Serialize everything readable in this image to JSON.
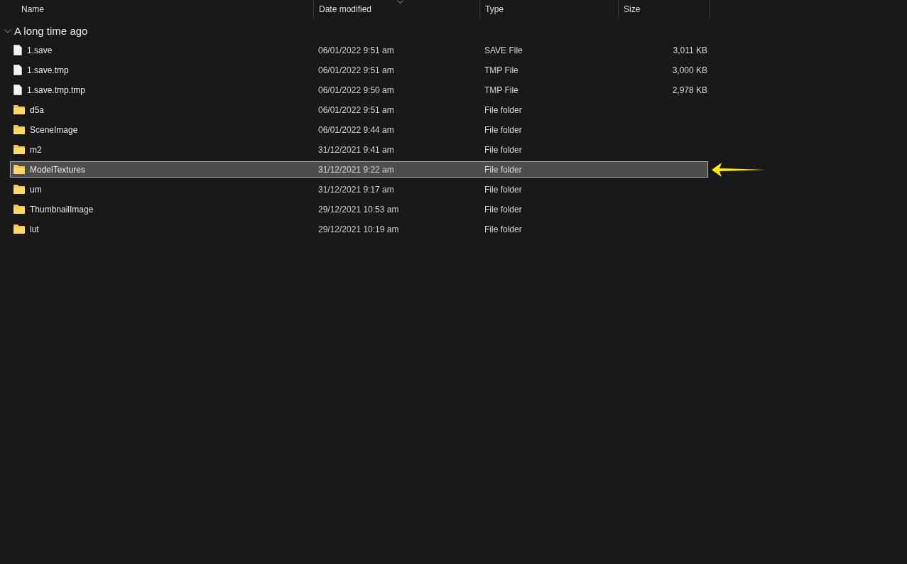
{
  "columns": [
    {
      "label": "Name",
      "sorted": false
    },
    {
      "label": "Date modified",
      "sorted": true
    },
    {
      "label": "Type",
      "sorted": false
    },
    {
      "label": "Size",
      "sorted": false
    }
  ],
  "group": {
    "label": "A long time ago",
    "expanded": true
  },
  "rows": [
    {
      "kind": "file",
      "name": "1.save",
      "date": "06/01/2022 9:51 am",
      "type": "SAVE File",
      "size": "3,011 KB",
      "selected": false
    },
    {
      "kind": "file",
      "name": "1.save.tmp",
      "date": "06/01/2022 9:51 am",
      "type": "TMP File",
      "size": "3,000 KB",
      "selected": false
    },
    {
      "kind": "file",
      "name": "1.save.tmp.tmp",
      "date": "06/01/2022 9:50 am",
      "type": "TMP File",
      "size": "2,978 KB",
      "selected": false
    },
    {
      "kind": "folder",
      "name": "d5a",
      "date": "06/01/2022 9:51 am",
      "type": "File folder",
      "selected": false
    },
    {
      "kind": "folder",
      "name": "SceneImage",
      "date": "06/01/2022 9:44 am",
      "type": "File folder",
      "selected": false
    },
    {
      "kind": "folder",
      "name": "m2",
      "date": "31/12/2021 9:41 am",
      "type": "File folder",
      "selected": false
    },
    {
      "kind": "folder",
      "name": "ModelTextures",
      "date": "31/12/2021 9:22 am",
      "type": "File folder",
      "selected": true
    },
    {
      "kind": "folder",
      "name": "um",
      "date": "31/12/2021 9:17 am",
      "type": "File folder",
      "selected": false
    },
    {
      "kind": "folder",
      "name": "ThumbnailImage",
      "date": "29/12/2021 10:53 am",
      "type": "File folder",
      "selected": false
    },
    {
      "kind": "folder",
      "name": "lut",
      "date": "29/12/2021 10:19 am",
      "type": "File folder",
      "selected": false
    }
  ]
}
